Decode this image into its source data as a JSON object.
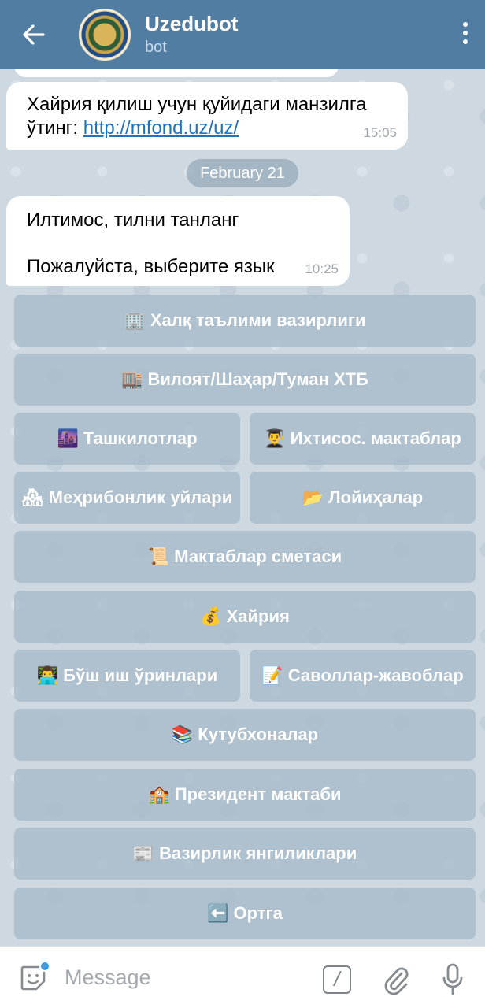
{
  "header": {
    "title": "Uzedubot",
    "subtitle": "bot"
  },
  "messages": [
    {
      "text": "Хайрия қилиш учун қуйидаги манзилга ўтинг: ",
      "link": "http://mfond.uz/uz/",
      "time": "15:05"
    },
    {
      "line1": "Илтимос, тилни танланг",
      "line2": "Пожалуйста, выберите язык",
      "time": "10:25"
    }
  ],
  "date_separator": "February 21",
  "keyboard": [
    {
      "emoji": "🏢",
      "label": "Халқ таълими вазирлиги"
    },
    {
      "emoji": "🏬",
      "label": "Вилоят/Шаҳар/Туман ХТБ"
    },
    {
      "emoji": "🌆",
      "label": "Ташкилотлар"
    },
    {
      "emoji": "👨‍🎓",
      "label": "Ихтисос. мактаблар"
    },
    {
      "emoji": "🏘",
      "label": "Меҳрибонлик уйлари"
    },
    {
      "emoji": "📂",
      "label": "Лойиҳалар"
    },
    {
      "emoji": "📜",
      "label": "Мактаблар сметаси"
    },
    {
      "emoji": "💰",
      "label": "Хайрия"
    },
    {
      "emoji": "👨‍💻",
      "label": "Бўш иш ўринлари"
    },
    {
      "emoji": "📝",
      "label": "Саволлар-жавоблар"
    },
    {
      "emoji": "📚",
      "label": "Кутубхоналар"
    },
    {
      "emoji": "🏫",
      "label": "Президент мактаби"
    },
    {
      "emoji": "📰",
      "label": "Вазирлик янгиликлари"
    },
    {
      "emoji": "⬅️",
      "label": "Ортга"
    }
  ],
  "input": {
    "placeholder": "Message"
  },
  "icons": {
    "back": "arrow-left-icon",
    "menu": "more-vertical-icon",
    "sticker": "sticker-icon",
    "command": "bot-command-icon",
    "attach": "paperclip-icon",
    "mic": "microphone-icon"
  },
  "colors": {
    "header": "#517da2",
    "link": "#1e73be",
    "keyboard_button": "#a6bac9"
  }
}
